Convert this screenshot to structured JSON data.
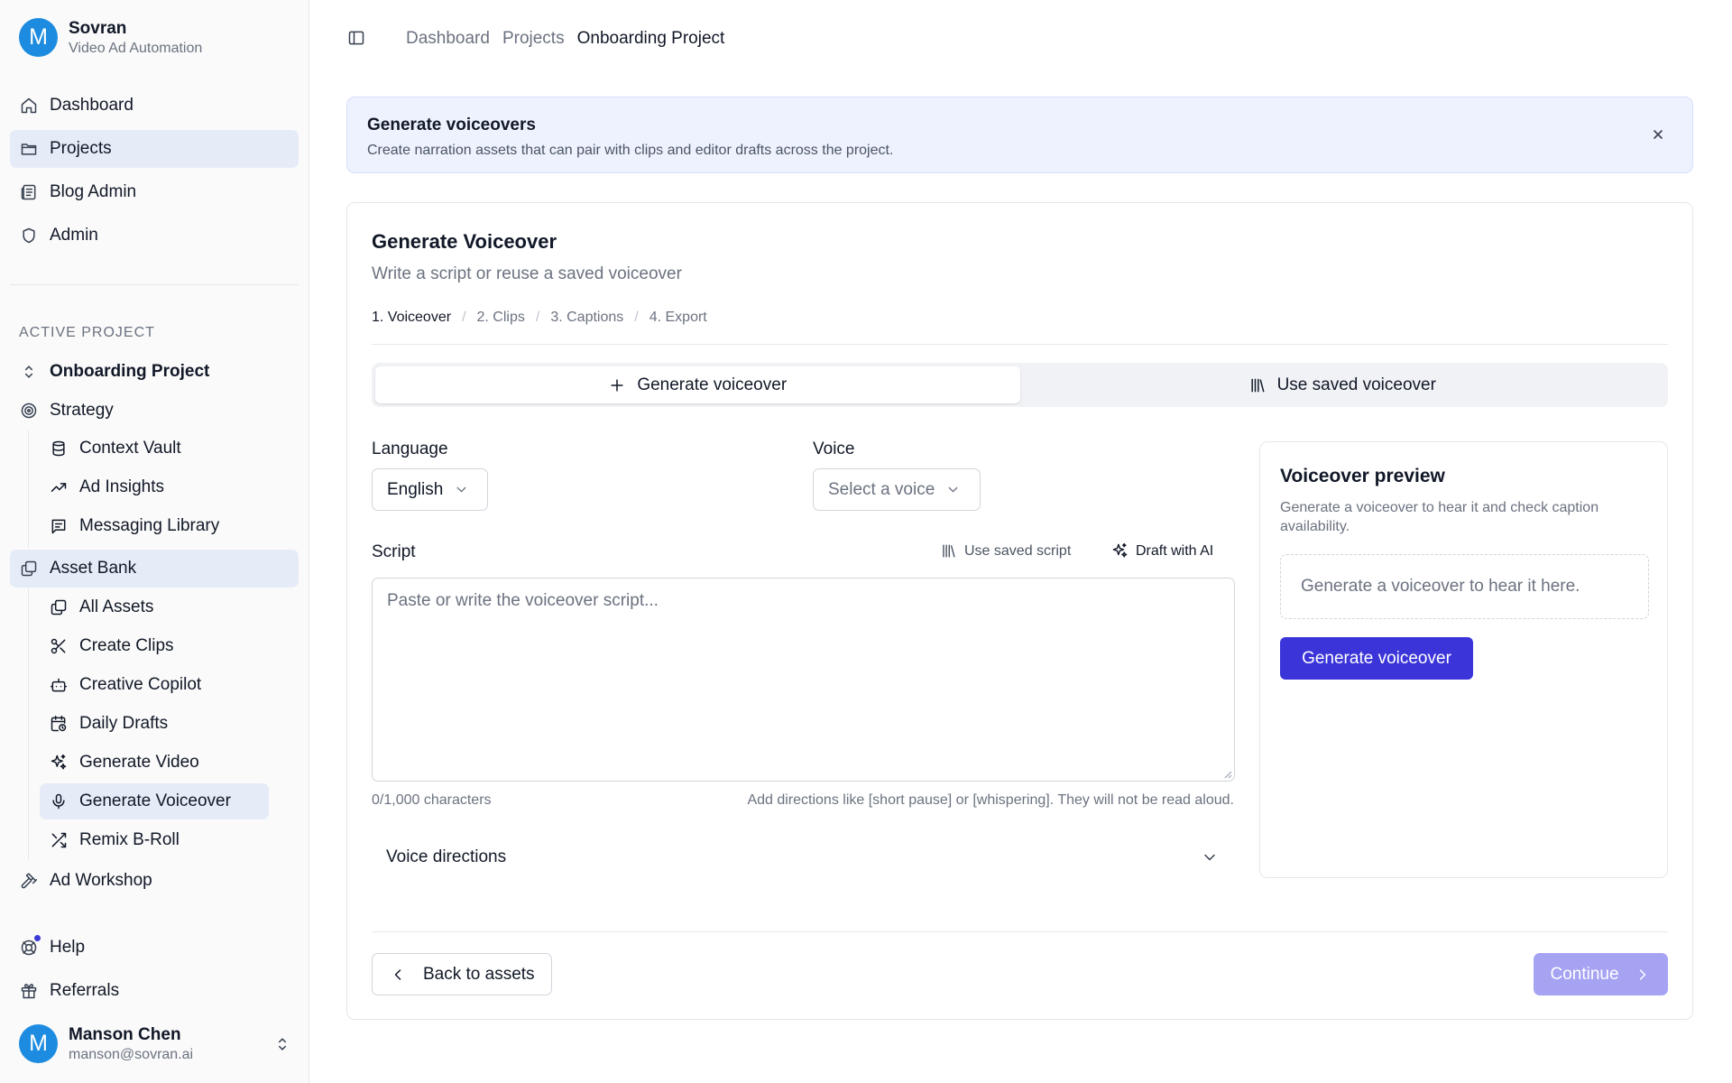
{
  "workspace": {
    "avatar_letter": "M",
    "name": "Sovran",
    "subtitle": "Video Ad Automation"
  },
  "nav_main": [
    {
      "label": "Dashboard",
      "icon": "home-icon"
    },
    {
      "label": "Projects",
      "icon": "folder-icon",
      "active": true
    },
    {
      "label": "Blog Admin",
      "icon": "newspaper-icon"
    },
    {
      "label": "Admin",
      "icon": "shield-icon"
    }
  ],
  "active_project": {
    "section_label": "ACTIVE PROJECT",
    "project_name": "Onboarding Project",
    "strategy": {
      "label": "Strategy",
      "items": [
        "Context Vault",
        "Ad Insights",
        "Messaging Library"
      ]
    },
    "asset_bank": {
      "label": "Asset Bank",
      "items": [
        "All Assets",
        "Create Clips",
        "Creative Copilot",
        "Daily Drafts",
        "Generate Video",
        "Generate Voiceover",
        "Remix B-Roll"
      ],
      "active_item": "Generate Voiceover"
    },
    "ad_workshop": "Ad Workshop"
  },
  "nav_bottom": {
    "help": "Help",
    "referrals": "Referrals"
  },
  "user": {
    "avatar_letter": "M",
    "name": "Manson Chen",
    "email": "manson@sovran.ai"
  },
  "breadcrumbs": [
    "Dashboard",
    "Projects",
    "Onboarding Project"
  ],
  "banner": {
    "title": "Generate voiceovers",
    "text": "Create narration assets that can pair with clips and editor drafts across the project."
  },
  "card": {
    "title": "Generate Voiceover",
    "subtitle": "Write a script or reuse a saved voiceover",
    "steps": [
      "1. Voiceover",
      "2. Clips",
      "3. Captions",
      "4. Export"
    ],
    "step_separator": "/",
    "active_step": 0,
    "mode_tabs": {
      "generate": "Generate voiceover",
      "saved": "Use saved voiceover",
      "selected": "generate"
    },
    "language": {
      "label": "Language",
      "value": "English"
    },
    "voice": {
      "label": "Voice",
      "placeholder": "Select a voice"
    },
    "script": {
      "label": "Script",
      "use_saved": "Use saved script",
      "draft_ai": "Draft with AI",
      "placeholder": "Paste or write the voiceover script...",
      "counter": "0/1,000 characters",
      "hint": "Add directions like [short pause] or [whispering]. They will not be read aloud."
    },
    "voice_directions": "Voice directions",
    "preview": {
      "title": "Voiceover preview",
      "text": "Generate a voiceover to hear it and check caption availability.",
      "empty": "Generate a voiceover to hear it here.",
      "button": "Generate voiceover"
    },
    "back_button": "Back to assets",
    "continue_button": "Continue"
  },
  "colors": {
    "primary": "#3b35d9",
    "primary_disabled": "#a5a3f2",
    "active_nav_bg": "#e6ecf7",
    "banner_bg": "#eef2ff",
    "avatar": "#1d8ce0"
  }
}
